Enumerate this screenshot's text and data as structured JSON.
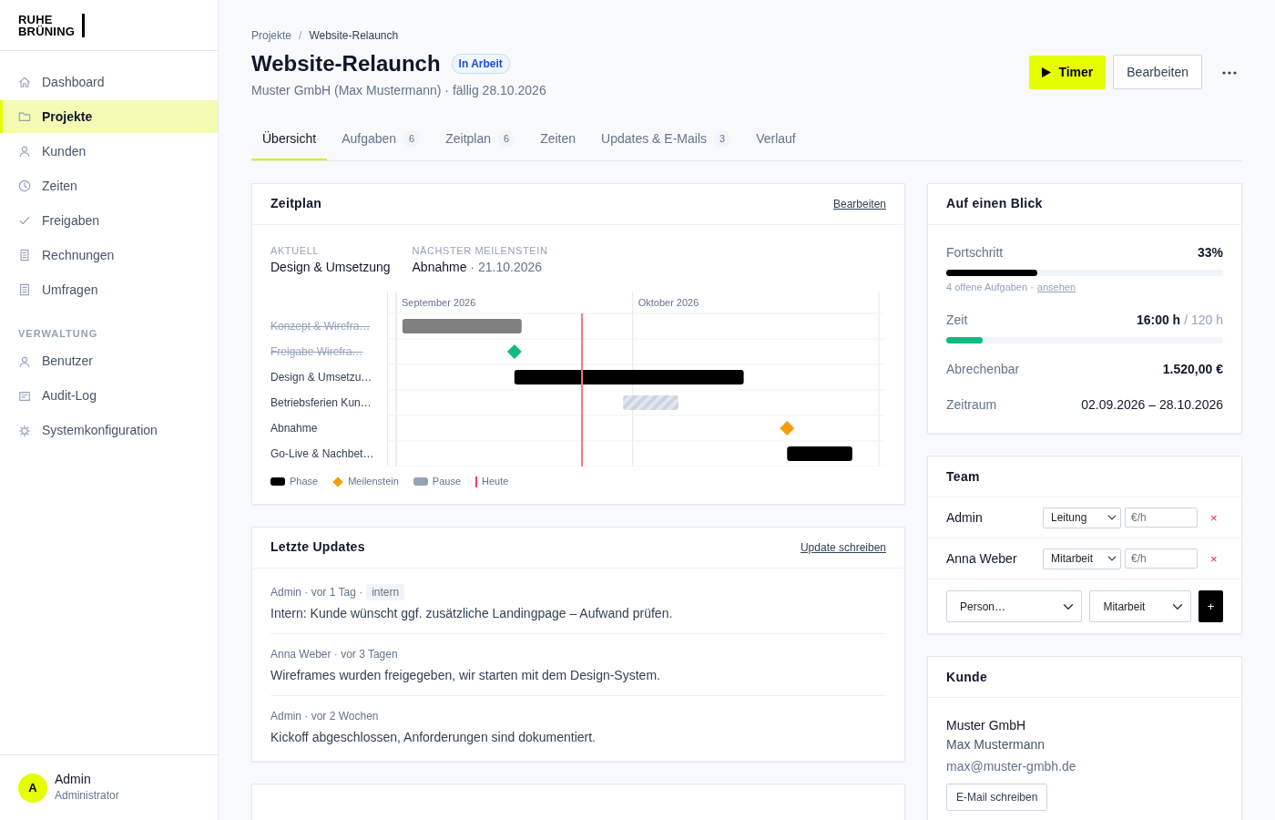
{
  "sidebar": {
    "logo": [
      "RUHE",
      "BRÜNING"
    ],
    "items": [
      {
        "label": "Dashboard",
        "selected": false
      },
      {
        "label": "Projekte",
        "selected": true
      },
      {
        "label": "Kunden",
        "selected": false
      },
      {
        "label": "Zeiten",
        "selected": false
      },
      {
        "label": "Freigaben",
        "selected": false
      },
      {
        "label": "Rechnungen",
        "selected": false
      },
      {
        "label": "Umfragen",
        "selected": false
      }
    ],
    "section": "VERWALTUNG",
    "admin_items": [
      {
        "label": "Benutzer",
        "selected": false
      },
      {
        "label": "Audit-Log",
        "selected": false
      },
      {
        "label": "Systemkonfiguration",
        "selected": false
      }
    ],
    "user": {
      "initial": "A",
      "name": "Admin",
      "role": "Administrator"
    }
  },
  "breadcrumb": [
    "Projekte",
    "/",
    "Website-Relaunch"
  ],
  "project": {
    "title": "Website-Relaunch",
    "status": "In Arbeit",
    "subtitle": "Muster GmbH (Max Mustermann) · fällig 28.10.2026"
  },
  "actions": {
    "timer": "Timer",
    "edit": "Bearbeiten"
  },
  "tabs": [
    {
      "label": "Übersicht",
      "selected": true
    },
    {
      "label": "Aufgaben",
      "count": "6",
      "selected": false
    },
    {
      "label": "Zeitplan",
      "count": "6",
      "selected": false
    },
    {
      "label": "Zeiten",
      "selected": false
    },
    {
      "label": "Updates & E-Mails",
      "count": "3",
      "selected": false
    },
    {
      "label": "Verlauf",
      "selected": false
    }
  ],
  "schedule": {
    "title": "Zeitplan",
    "action": "Bearbeiten",
    "current": {
      "label": "AKTUELL",
      "value": "Design & Umsetzung"
    },
    "next": {
      "label": "NÄCHSTER MEILENSTEIN",
      "name": "Abnahme",
      "date": "· 21.10.2026"
    },
    "rows": [
      {
        "label": "Konzept & Wirefra…",
        "kind": "phase",
        "done": true
      },
      {
        "label": "Freigabe Wirefra…",
        "kind": "milestone",
        "done": true
      },
      {
        "label": "Design & Umsetzu…",
        "kind": "phase",
        "done": false
      },
      {
        "label": "Betriebsferien Kun…",
        "kind": "pause",
        "done": false
      },
      {
        "label": "Abnahme",
        "kind": "milestone",
        "done": false
      },
      {
        "label": "Go-Live & Nachbet…",
        "kind": "phase",
        "done": false
      }
    ],
    "months": [
      "September 2026",
      "Oktober 2026"
    ],
    "legend": [
      {
        "kind": "phase",
        "label": "Phase"
      },
      {
        "kind": "milestone",
        "label": "Meilenstein"
      },
      {
        "kind": "pause",
        "label": "Pause"
      },
      {
        "kind": "today",
        "label": "Heute"
      }
    ]
  },
  "updates": {
    "title": "Letzte Updates",
    "action": "Update schreiben",
    "items": [
      {
        "meta": "Admin · vor 1 Tag ·",
        "tag": "intern",
        "text": "Intern: Kunde wünscht ggf. zusätzliche Landingpage – Aufwand prüfen."
      },
      {
        "meta": "Anna Weber · vor 3 Tagen",
        "text": "Wireframes wurden freigegeben, wir starten mit dem Design-System."
      },
      {
        "meta": "Admin · vor 2 Wochen",
        "text": "Kickoff abgeschlossen, Anforderungen sind dokumentiert."
      }
    ]
  },
  "glance": {
    "title": "Auf einen Blick",
    "progress": {
      "label": "Fortschritt",
      "value": "33%",
      "level": 0.33,
      "note": "4 offene Aufgaben ·",
      "link": "ansehen"
    },
    "time": {
      "label": "Zeit",
      "value": "16:00 h",
      "budget": "/ 120 h",
      "level": 0.133
    },
    "billable": {
      "label": "Abrechenbar",
      "value": "1.520,00 €"
    },
    "period": {
      "label": "Zeitraum",
      "value": "02.09.2026 – 28.10.2026"
    }
  },
  "team": {
    "title": "Team",
    "members": [
      {
        "name": "Admin",
        "role": "Leitung",
        "rate_placeholder": "€/h",
        "remove": "×"
      },
      {
        "name": "Anna Weber",
        "role": "Mitarbeit",
        "rate_placeholder": "€/h",
        "remove": "×"
      }
    ],
    "add": {
      "person": "Person…",
      "role": "Mitarbeit",
      "button": "+"
    }
  },
  "customer": {
    "title": "Kunde",
    "company": "Muster GmbH",
    "contact": "Max Mustermann",
    "email": "max@muster-gmbh.de",
    "button": "E-Mail schreiben"
  }
}
